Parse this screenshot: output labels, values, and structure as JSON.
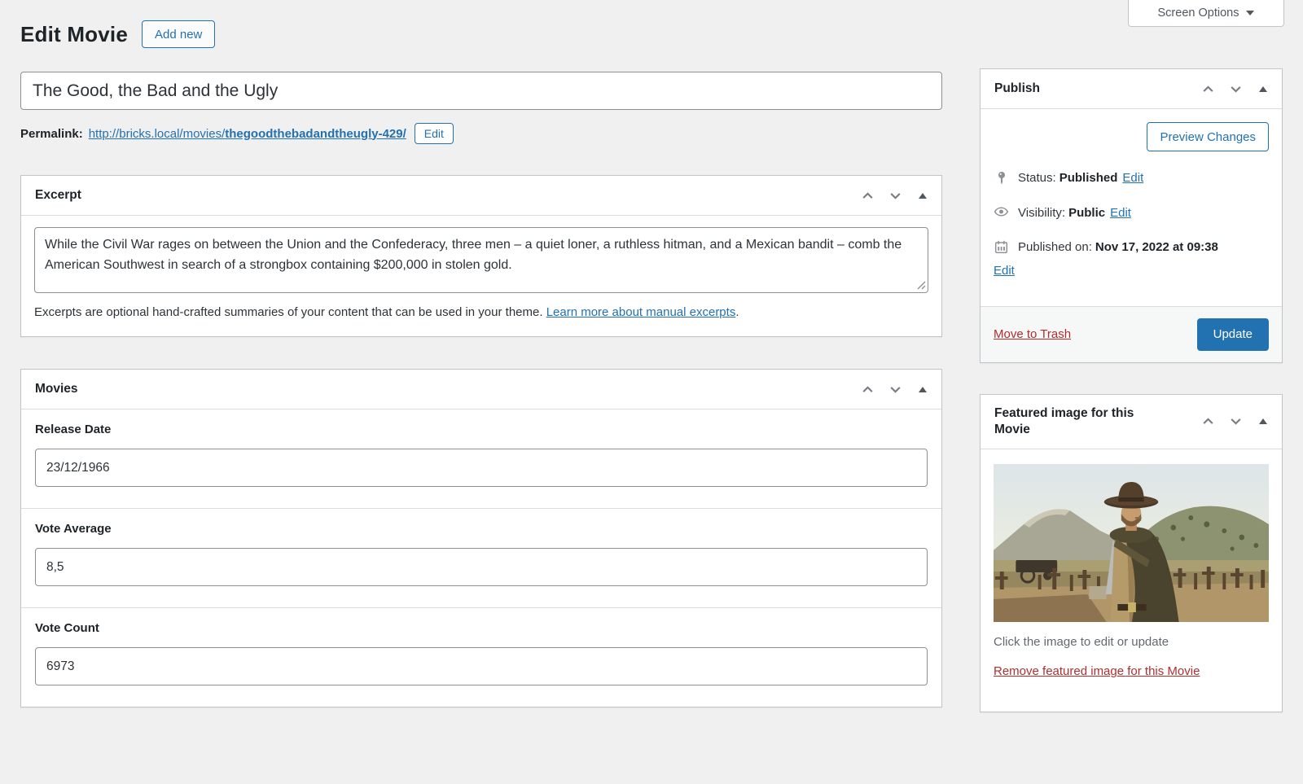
{
  "screen_options": {
    "label": "Screen Options"
  },
  "header": {
    "title": "Edit Movie",
    "add_new_label": "Add new"
  },
  "title_field": {
    "value": "The Good, the Bad and the Ugly"
  },
  "permalink": {
    "label": "Permalink:",
    "url_base": "http://bricks.local/movies/",
    "url_slug": "thegoodthebadandtheugly-429/",
    "edit_label": "Edit"
  },
  "excerpt_box": {
    "title": "Excerpt",
    "value": "While the Civil War rages on between the Union and the Confederacy, three men – a quiet loner, a ruthless hitman, and a Mexican bandit – comb the American Southwest in search of a strongbox containing $200,000 in stolen gold.",
    "help_text": "Excerpts are optional hand-crafted summaries of your content that can be used in your theme. ",
    "help_link": "Learn more about manual excerpts",
    "help_suffix": "."
  },
  "movies_box": {
    "title": "Movies",
    "fields": [
      {
        "label": "Release Date",
        "value": "23/12/1966"
      },
      {
        "label": "Vote Average",
        "value": "8,5"
      },
      {
        "label": "Vote Count",
        "value": "6973"
      }
    ]
  },
  "publish_box": {
    "title": "Publish",
    "preview_label": "Preview Changes",
    "status": {
      "label": "Status:",
      "value": "Published",
      "edit": "Edit"
    },
    "visibility": {
      "label": "Visibility:",
      "value": "Public",
      "edit": "Edit"
    },
    "published": {
      "label": "Published on:",
      "value": "Nov 17, 2022 at 09:38",
      "edit": "Edit"
    },
    "trash_label": "Move to Trash",
    "update_label": "Update"
  },
  "featured_box": {
    "title": "Featured image for this Movie",
    "caption": "Click the image to edit or update",
    "remove_label": "Remove featured image for this Movie"
  },
  "colors": {
    "accent": "#2271b1",
    "danger": "#b32d2e",
    "text": "#1d2327",
    "muted": "#646970",
    "border": "#c3c4c7",
    "input_border": "#8c8f94",
    "page_bg": "#f0f0f1"
  }
}
